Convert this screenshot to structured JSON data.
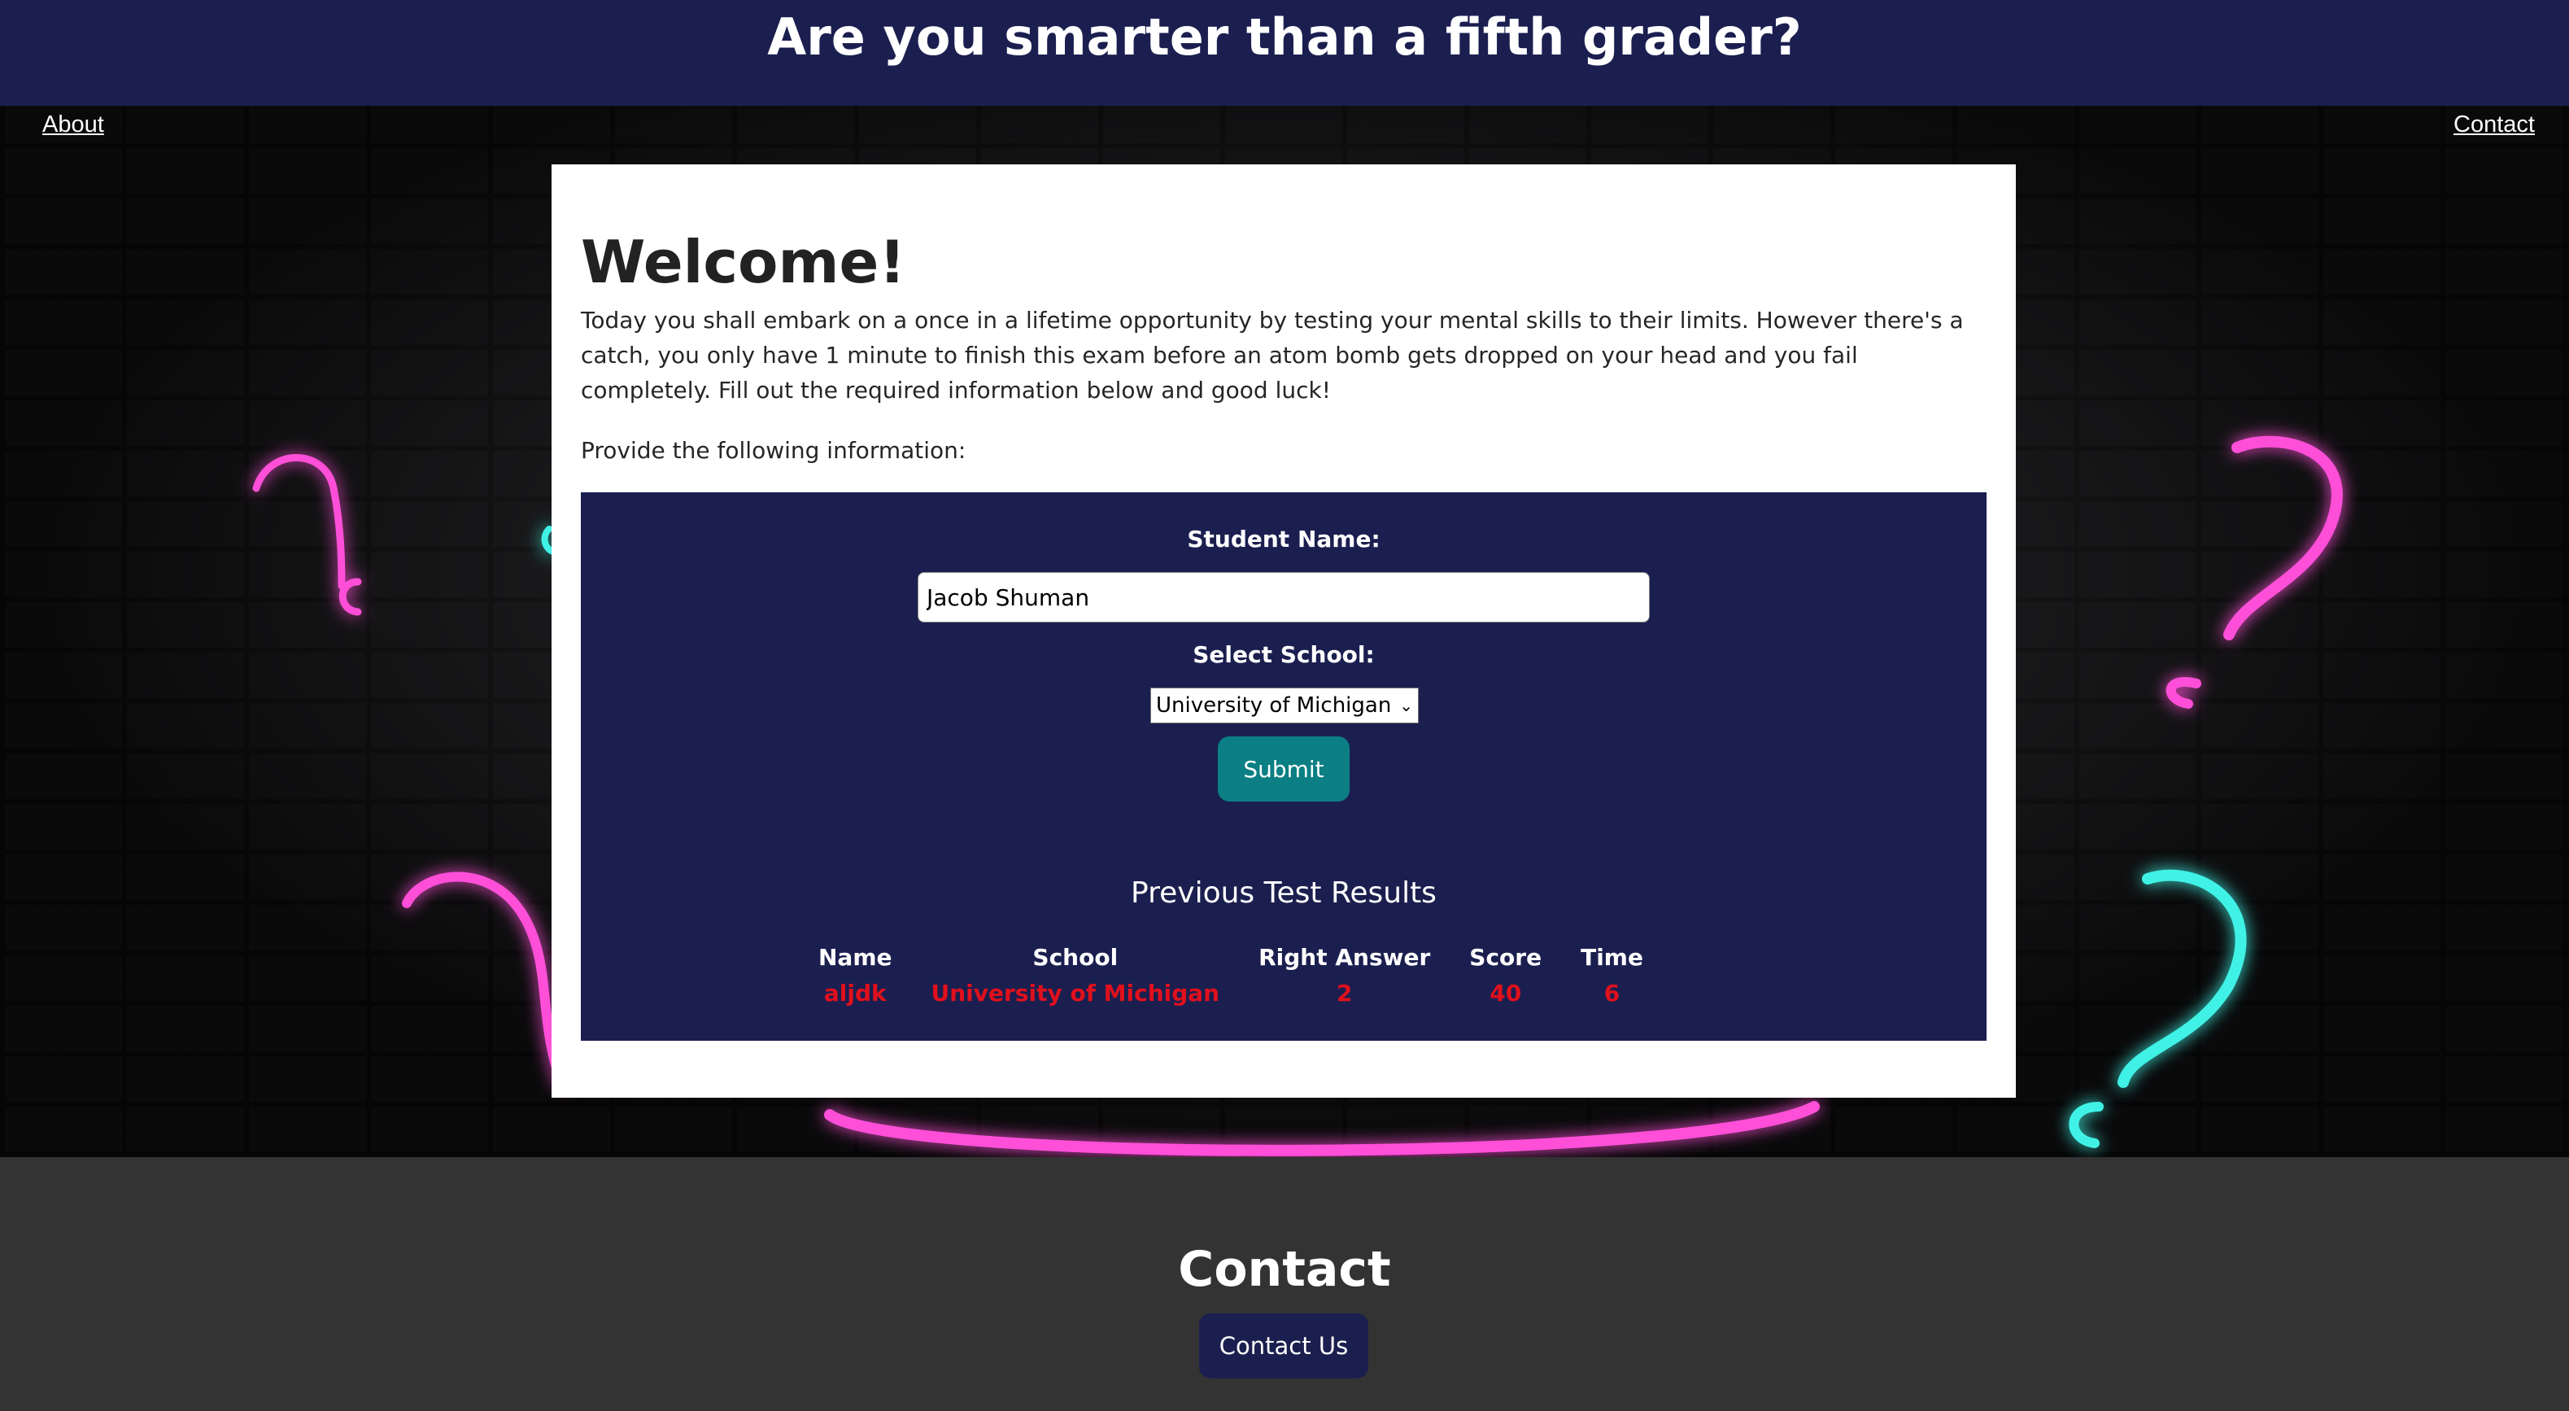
{
  "header": {
    "title": "Are you smarter than a fifth grader?"
  },
  "nav": {
    "about": "About",
    "contact": "Contact"
  },
  "main": {
    "heading": "Welcome!",
    "intro": "Today you shall embark on a once in a lifetime opportunity by testing your mental skills to their limits. However there's a catch, you only have 1 minute to finish this exam before an atom bomb gets dropped on your head and you fail completely. Fill out the required information below and good luck!",
    "provide": "Provide the following information:"
  },
  "form": {
    "name_label": "Student Name:",
    "name_value": "Jacob Shuman",
    "school_label": "Select School:",
    "school_selected": "University of Michigan",
    "submit_label": "Submit"
  },
  "results": {
    "title": "Previous Test Results",
    "columns": [
      "Name",
      "School",
      "Right Answer",
      "Score",
      "Time"
    ],
    "rows": [
      [
        "aljdk",
        "University of Michigan",
        "2",
        "40",
        "6"
      ]
    ]
  },
  "footer": {
    "title": "Contact",
    "button_label": "Contact Us"
  },
  "colors": {
    "header_bg": "#1b1f4f",
    "submit_bg": "#0b7f84",
    "result_text": "#e0101c",
    "footer_bg": "#333333"
  }
}
